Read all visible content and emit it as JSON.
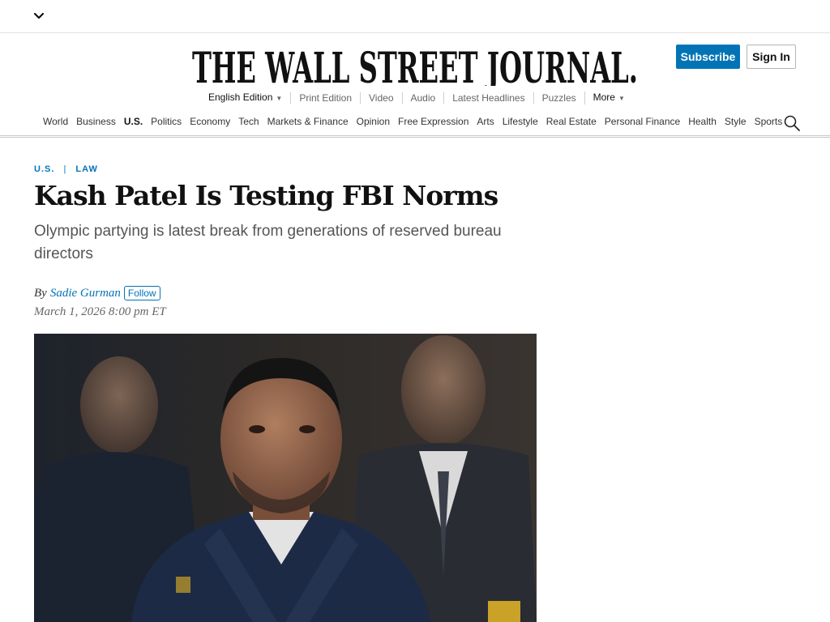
{
  "masthead": {
    "title": "THE WALL STREET JOURNAL."
  },
  "account": {
    "subscribe_label": "Subscribe",
    "signin_label": "Sign In"
  },
  "subnav": {
    "edition": "English Edition",
    "items": [
      "Print Edition",
      "Video",
      "Audio",
      "Latest Headlines",
      "Puzzles"
    ],
    "more": "More"
  },
  "nav": {
    "items": [
      "World",
      "Business",
      "U.S.",
      "Politics",
      "Economy",
      "Tech",
      "Markets & Finance",
      "Opinion",
      "Free Expression",
      "Arts",
      "Lifestyle",
      "Real Estate",
      "Personal Finance",
      "Health",
      "Style",
      "Sports"
    ],
    "active": "U.S."
  },
  "article": {
    "section": "U.S.",
    "subsection": "Law",
    "headline": "Kash Patel Is Testing FBI Norms",
    "dek": "Olympic partying is latest break from generations of reserved bureau directors",
    "by": "By",
    "author": "Sadie Gurman",
    "follow_label": "Follow",
    "date": "March 1, 2026 8:00 pm ET"
  },
  "colors": {
    "accent": "#0274b6",
    "text": "#111111",
    "muted": "#555555"
  },
  "icons": {
    "menu": "chevron-down-icon",
    "search": "search-icon"
  }
}
